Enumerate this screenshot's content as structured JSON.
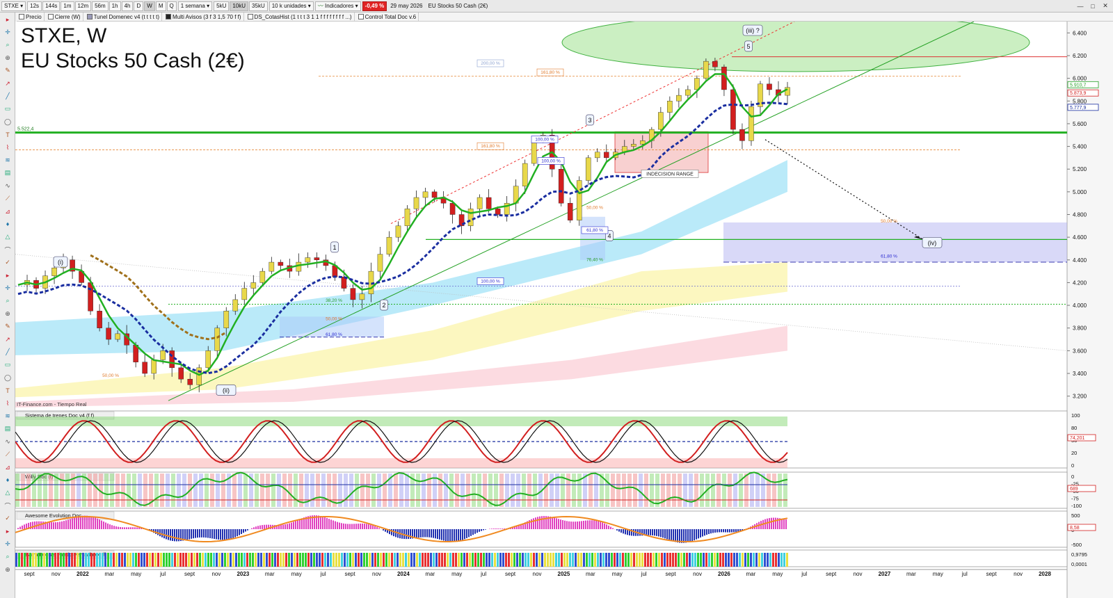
{
  "toolbar": {
    "symbol": "STXE",
    "intervals": [
      "12s",
      "144s",
      "1m",
      "12m",
      "56m",
      "1h",
      "4h",
      "D",
      "W",
      "M",
      "Q"
    ],
    "active_interval": "W",
    "period": "1 semana",
    "ticks": [
      "5kU",
      "10kU",
      "35kU"
    ],
    "active_tick": "10kU",
    "units": "10 k unidades",
    "indicators_label": "Indicadores",
    "change": "-0,49 %",
    "date": "29 may 2026",
    "instrument": "EU Stocks 50 Cash (2€)"
  },
  "legend": [
    {
      "label": "Precio"
    },
    {
      "label": "Cierre (W)"
    },
    {
      "label": "Tunel Domenec v4 (t t t t t)"
    },
    {
      "label": "Multi Avisos (3 f 3 1,5 70 f f)"
    },
    {
      "label": "DS_CotasHist (1 t t t 3 1 1 f f f f f f f f ...)"
    },
    {
      "label": "Control Total Doc v.6"
    }
  ],
  "chart_title": {
    "line1": "STXE, W",
    "line2": "EU Stocks 50 Cash (2€)"
  },
  "source_label": "IT-Finance.com - Tiempo Real",
  "price_level_label": "5.522,4",
  "chart_data": {
    "type": "line",
    "title": "STXE, W",
    "subtitle": "EU Stocks 50 Cash (2€)",
    "ylim": [
      3100,
      6500
    ],
    "y_ticks": [
      3200,
      3400,
      3600,
      3800,
      4000,
      4200,
      4400,
      4600,
      4800,
      5000,
      5200,
      5400,
      5600,
      5800,
      6000,
      6200,
      6400
    ],
    "y_tick_labels": [
      "3.200",
      "3.400",
      "3.600",
      "3.800",
      "4.000",
      "4.200",
      "4.400",
      "4.600",
      "4.800",
      "5.000",
      "5.200",
      "5.400",
      "5.600",
      "5.800",
      "6.000",
      "6.200",
      "6.400"
    ],
    "x_tick_labels": [
      "sept",
      "nov",
      "2022",
      "mar",
      "may",
      "jul",
      "sept",
      "nov",
      "2023",
      "mar",
      "may",
      "jul",
      "sept",
      "nov",
      "2024",
      "mar",
      "may",
      "jul",
      "sept",
      "nov",
      "2025",
      "mar",
      "may",
      "jul",
      "sept",
      "nov",
      "2026",
      "mar",
      "may",
      "jul",
      "sept",
      "nov",
      "2027",
      "mar",
      "may",
      "jul",
      "sept",
      "nov",
      "2028"
    ],
    "right_labels": [
      "5.910,7",
      "5.873,9",
      "5.777,9"
    ],
    "series": [
      {
        "name": "Cierre (W)",
        "values": [
          4180,
          4220,
          4150,
          4260,
          4330,
          4400,
          4300,
          4200,
          3950,
          3800,
          3700,
          3750,
          3650,
          3500,
          3400,
          3520,
          3600,
          3450,
          3350,
          3300,
          3450,
          3600,
          3800,
          3950,
          4050,
          4150,
          4200,
          4300,
          4380,
          4350,
          4300,
          4380,
          4420,
          4400,
          4350,
          4250,
          4150,
          4050,
          4100,
          4300,
          4450,
          4600,
          4700,
          4850,
          4950,
          5000,
          4950,
          4900,
          4800,
          4700,
          4850,
          4950,
          4850,
          4800,
          4900,
          5050,
          5250,
          5450,
          5500,
          5200,
          4900,
          4750,
          5100,
          5300,
          5350,
          5300,
          5350,
          5400,
          5420,
          5450,
          5550,
          5700,
          5800,
          5850,
          5900,
          6000,
          6150,
          6100,
          5900,
          5550,
          5450,
          5750,
          5950,
          5900,
          5850,
          5920
        ]
      }
    ],
    "wave_labels": [
      "(i)",
      "(ii)",
      "1",
      "2",
      "3",
      "4",
      "(iii) ?",
      "5",
      "(iv)"
    ],
    "fib_labels": [
      "200,00 %",
      "161,80 %",
      "161,80 %",
      "100,00 %",
      "100,00 %",
      "50,00 %",
      "61,80 %",
      "76,40 %",
      "100,00 %",
      "38,20 %",
      "50,00 %",
      "61,80 %",
      "50,00 %",
      "61,80 %",
      "50,00 %"
    ],
    "annotation": "INDECISION RANGE",
    "grid": false
  },
  "panels": [
    {
      "title": "Sistema de trenes Doc v4 (f f)",
      "ticks": [
        "100",
        "80",
        "50",
        "20",
        "0"
      ],
      "values": [
        "74,201"
      ]
    },
    {
      "title": "Willy Doc (t)",
      "ticks": [
        "0",
        "-25",
        "-50",
        "-75",
        "-100"
      ],
      "values": [
        "689"
      ]
    },
    {
      "title": "Awesome Evolution Doc",
      "ticks": [
        "500",
        "0",
        "-500"
      ],
      "values": [
        "8,58"
      ]
    },
    {
      "title": "Barra Fuerza Fondo Mercado v4 (f)",
      "ticks": [
        "0,9795",
        "0,0001"
      ],
      "values": []
    }
  ],
  "colors": {
    "accent_green": "#22b022",
    "down_red": "#d21f1f",
    "up_yellow": "#e8d84a",
    "dashed_blue": "#1a2ea0"
  }
}
